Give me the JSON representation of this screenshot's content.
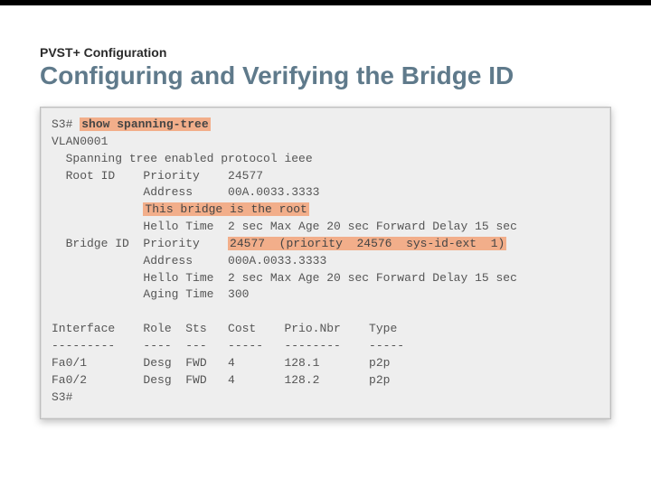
{
  "eyebrow": "PVST+ Configuration",
  "title": "Configuring and Verifying the Bridge ID",
  "term": {
    "prompt": "S3#",
    "command": "show spanning-tree",
    "vlan_line": "VLAN0001",
    "proto_line": "  Spanning tree enabled protocol ieee",
    "root_prio_label": "  Root ID    Priority    ",
    "root_prio_val": "24577",
    "root_addr_line": "             Address     00A.0033.3333",
    "root_note": "This bridge is the root",
    "root_note_pad": "             ",
    "root_hello_line": "             Hello Time  2 sec Max Age 20 sec Forward Delay 15 sec",
    "bid_prio_label": "  Bridge ID  Priority    ",
    "bid_prio_val": "24577  (priority  24576  sys-id-ext  1)",
    "bid_addr_line": "             Address     000A.0033.3333",
    "bid_hello_line": "             Hello Time  2 sec Max Age 20 sec Forward Delay 15 sec",
    "bid_aging_line": "             Aging Time  300",
    "hdr_line": "Interface    Role  Sts   Cost    Prio.Nbr    Type",
    "dash_line": "---------    ----  ---   -----   --------    -----",
    "row1": "Fa0/1        Desg  FWD   4       128.1       p2p",
    "row2": "Fa0/2        Desg  FWD   4       128.2       p2p",
    "end_prompt": "S3#"
  }
}
